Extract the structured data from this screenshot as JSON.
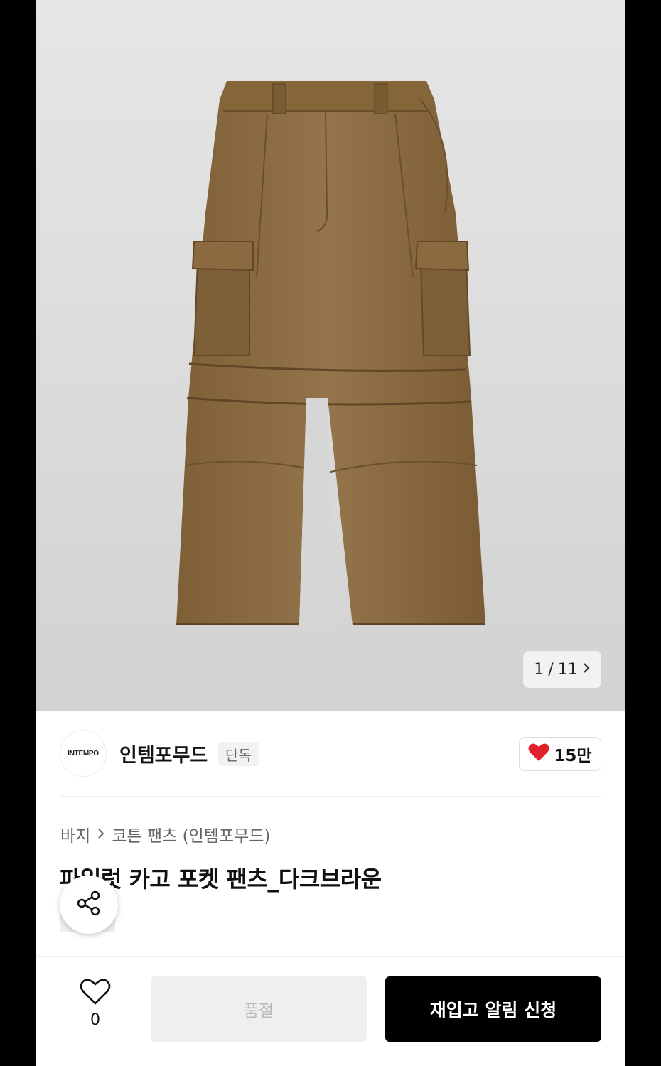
{
  "gallery": {
    "current": "1",
    "separator": "/",
    "total": "11",
    "next_icon": "chevron-right-icon"
  },
  "brand": {
    "logo_text": "INTEMPO",
    "name": "인템포무드",
    "badge": "단독",
    "likes": "15만",
    "like_icon": "heart-filled-icon",
    "like_color": "#e0202a"
  },
  "breadcrumb": {
    "level1": "바지",
    "separator": ">",
    "level2": "코튼 팬츠 (인템포무드)"
  },
  "product": {
    "title": "파일럿 카고 포켓 팬츠_다크브라운",
    "image_color": "#8a6a3e"
  },
  "bottom_bar": {
    "wish_icon": "heart-outline-icon",
    "wish_count": "0",
    "soldout_label": "품절",
    "restock_label": "재입고 알림 신청"
  }
}
